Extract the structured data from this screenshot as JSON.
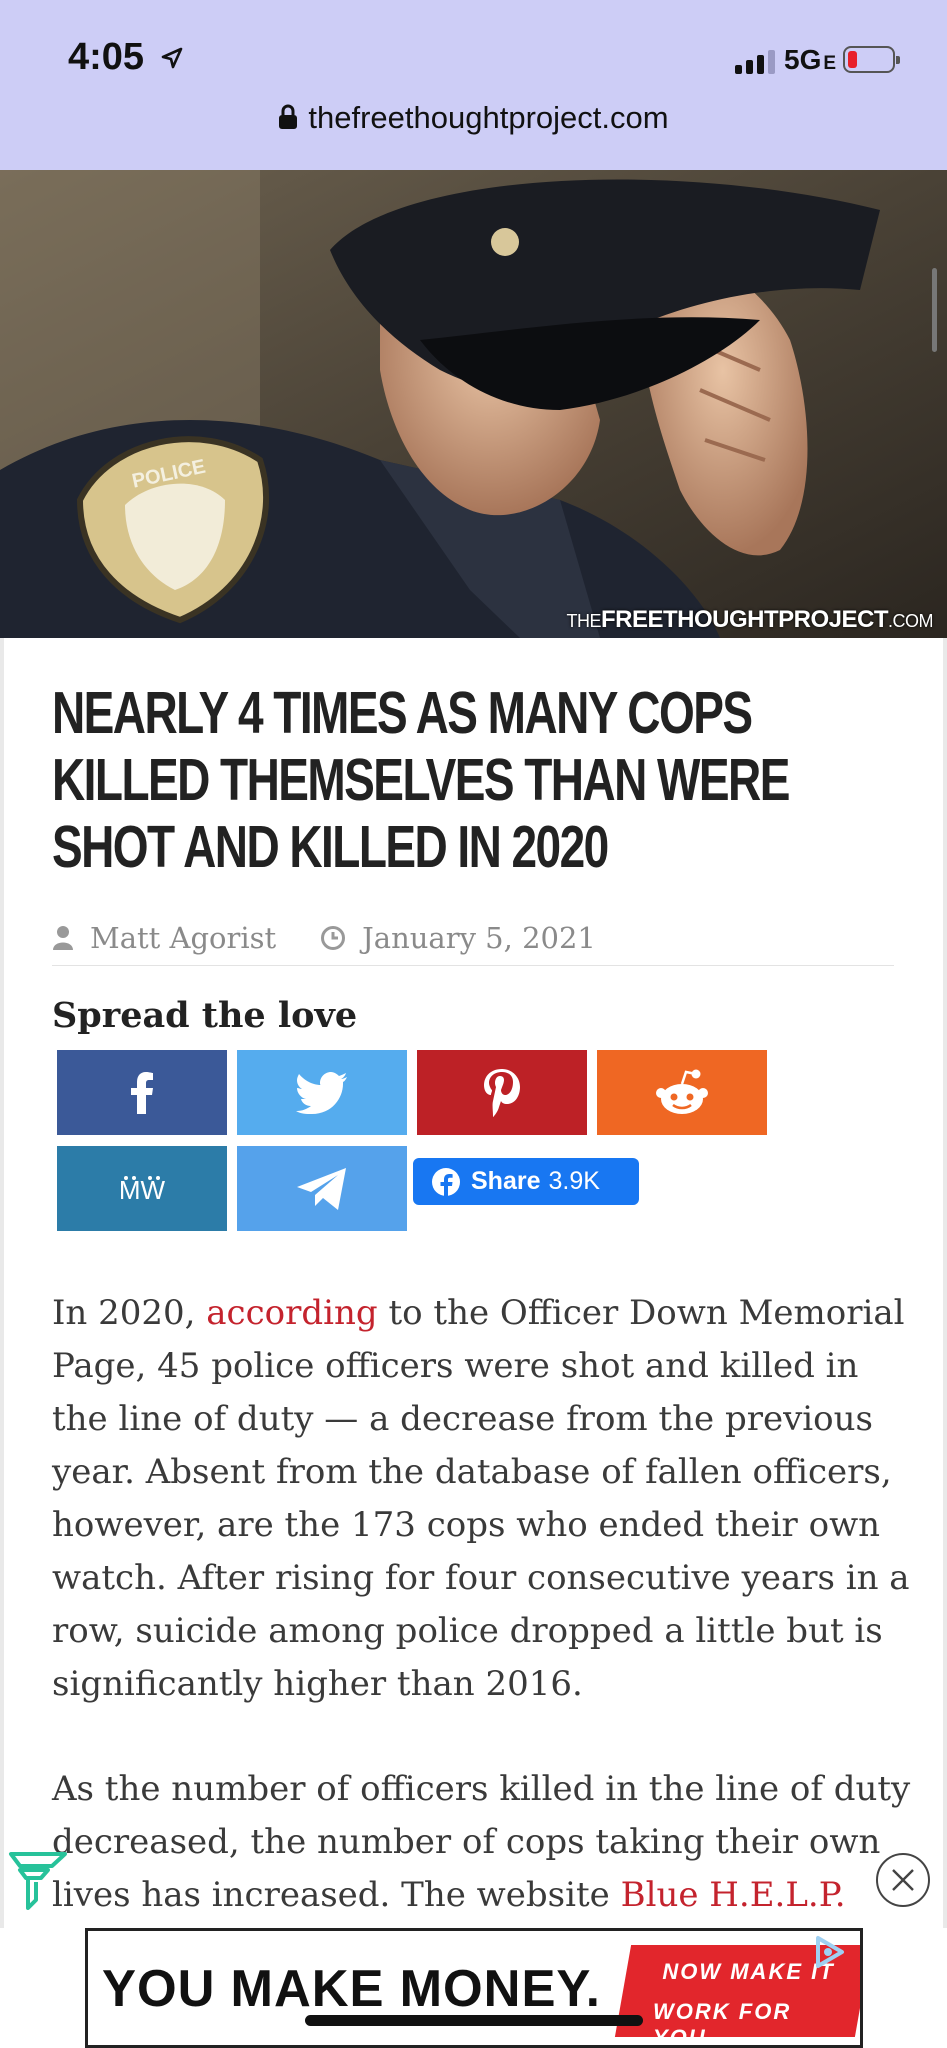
{
  "status_bar": {
    "time": "4:05",
    "network": "5G",
    "network_suffix": "E"
  },
  "browser": {
    "url": "thefreethoughtproject.com"
  },
  "hero": {
    "watermark_the": "THE",
    "watermark_main": "FREETHOUGHTPROJECT",
    "watermark_tld": ".COM"
  },
  "article": {
    "title": "Nearly 4 Times As Many Cops Killed Themselves Than Were Shot and Killed In 2020",
    "author": "Matt Agorist",
    "date": "January 5, 2021"
  },
  "share": {
    "heading": "Spread the love",
    "buttons": [
      {
        "network": "facebook",
        "icon": "facebook-icon",
        "color": "#3b5998"
      },
      {
        "network": "twitter",
        "icon": "twitter-icon",
        "color": "#55acee"
      },
      {
        "network": "pinterest",
        "icon": "pinterest-icon",
        "color": "#bd2126"
      },
      {
        "network": "reddit",
        "icon": "reddit-icon",
        "color": "#ef6723"
      },
      {
        "network": "mewe",
        "icon": "mewe-icon",
        "color": "#2c7ca8"
      },
      {
        "network": "telegram",
        "icon": "telegram-icon",
        "color": "#55a2eb"
      }
    ],
    "fb_share_label": "Share",
    "fb_share_count": "3.9K"
  },
  "body": {
    "p1_a": "In 2020, ",
    "p1_link": "according",
    "p1_b": " to the Officer Down Memorial Page, 45 police officers were shot and killed in the line of duty — a decrease from the previous year. Absent from the database of fallen officers, however, are the 173 cops who ended their own watch. After rising for four consecutive years in a row, suicide among police dropped a little but is significantly higher than 2016.",
    "p2_a": "As the number of officers killed in the line of duty decreased, the number of cops taking their own lives has increased. The website ",
    "p2_link": "Blue H.E.L.P.",
    "p2_b": ""
  },
  "ad": {
    "headline": "YOU MAKE MONEY.",
    "tag_line1": "NOW MAKE IT",
    "tag_line2": "WORK FOR YOU."
  },
  "colors": {
    "link": "#c4232d",
    "status_bg": "#cdcdf6",
    "battery_low": "#e8202a"
  }
}
